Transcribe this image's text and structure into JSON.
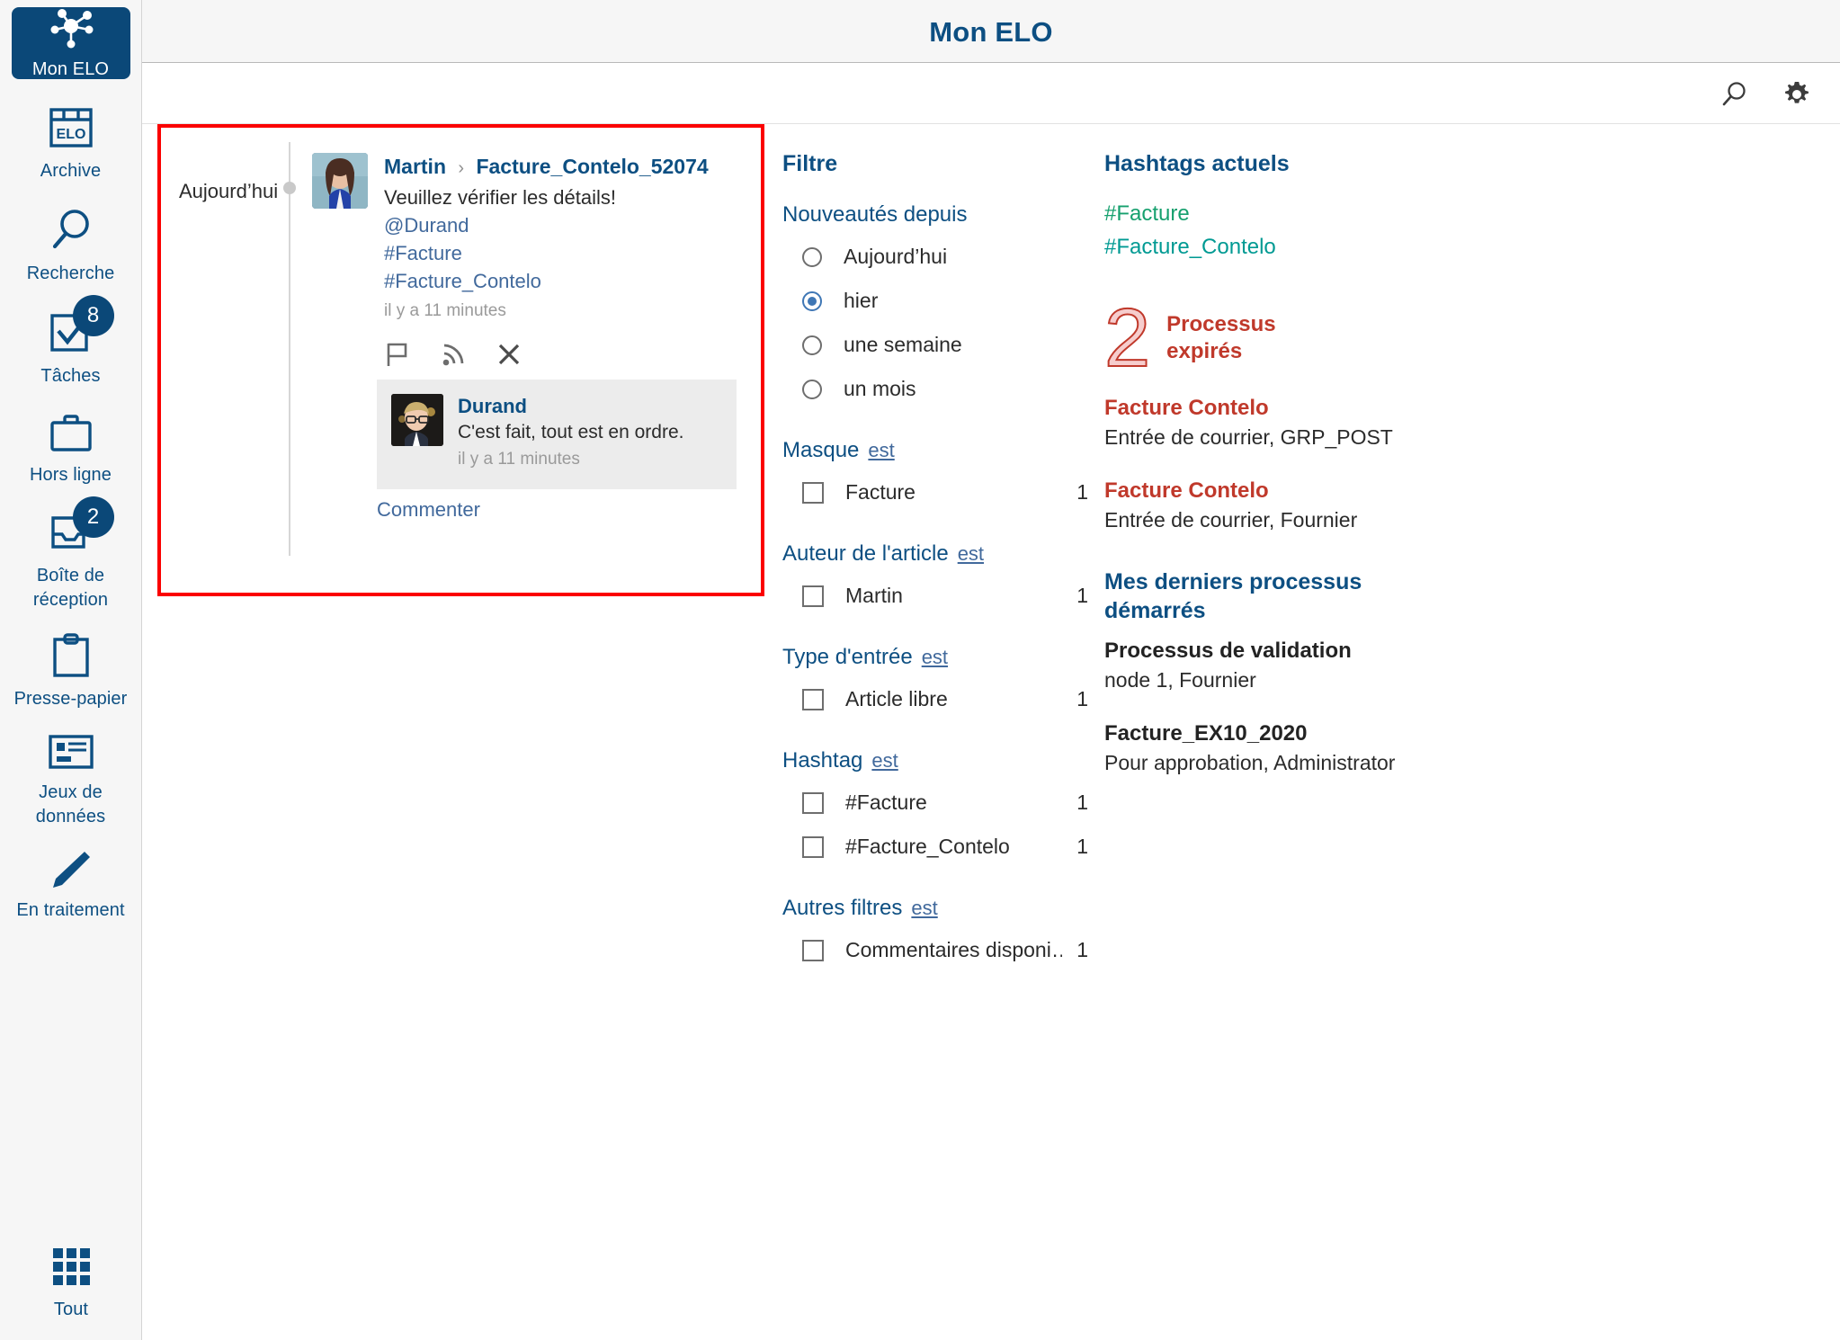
{
  "app": {
    "title": "Mon ELO"
  },
  "sidebar": {
    "items": [
      {
        "label": "Mon ELO",
        "icon": "network-nodes-icon",
        "active": true,
        "badge": null
      },
      {
        "label": "Archive",
        "icon": "elo-archive-icon",
        "active": false,
        "badge": null
      },
      {
        "label": "Recherche",
        "icon": "search-icon",
        "active": false,
        "badge": null
      },
      {
        "label": "Tâches",
        "icon": "checkbox-task-icon",
        "active": false,
        "badge": "8"
      },
      {
        "label": "Hors ligne",
        "icon": "briefcase-icon",
        "active": false,
        "badge": null
      },
      {
        "label": "Boîte de réception",
        "icon": "inbox-tray-icon",
        "active": false,
        "badge": "2"
      },
      {
        "label": "Presse-papier",
        "icon": "clipboard-icon",
        "active": false,
        "badge": null
      },
      {
        "label": "Jeux de données",
        "icon": "data-record-icon",
        "active": false,
        "badge": null
      },
      {
        "label": "En traitement",
        "icon": "pencil-icon",
        "active": false,
        "badge": null
      }
    ],
    "bottom": {
      "label": "Tout",
      "icon": "grid-apps-icon"
    }
  },
  "toolbar": {
    "search_icon": "search-icon",
    "settings_icon": "gear-icon"
  },
  "feed": {
    "day_label": "Aujourd’hui",
    "post": {
      "author": "Martin",
      "separator": "›",
      "target": "Facture_Contelo_52074",
      "text": "Veuillez vérifier les détails!",
      "mention": "@Durand",
      "hashtag1": "#Facture",
      "hashtag2": "#Facture_Contelo",
      "time": "il y a 11 minutes",
      "actions": [
        {
          "name": "flag-icon",
          "title": "flag"
        },
        {
          "name": "feed-subscribe-icon",
          "title": "subscribe"
        },
        {
          "name": "close-icon",
          "title": "close"
        }
      ]
    },
    "comment": {
      "author": "Durand",
      "text": "C'est fait, tout est en ordre.",
      "time": "il y a 11 minutes"
    },
    "comment_link": "Commenter"
  },
  "filters": {
    "title": "Filtre",
    "groups": [
      {
        "title": "Nouveautés depuis",
        "est": "",
        "type": "radio",
        "options": [
          {
            "label": "Aujourd’hui",
            "selected": false,
            "count": ""
          },
          {
            "label": "hier",
            "selected": true,
            "count": ""
          },
          {
            "label": "une semaine",
            "selected": false,
            "count": ""
          },
          {
            "label": "un mois",
            "selected": false,
            "count": ""
          }
        ]
      },
      {
        "title": "Masque",
        "est": "est",
        "type": "checkbox",
        "options": [
          {
            "label": "Facture",
            "selected": false,
            "count": "1"
          }
        ]
      },
      {
        "title": "Auteur de l'article",
        "est": "est",
        "type": "checkbox",
        "options": [
          {
            "label": "Martin",
            "selected": false,
            "count": "1"
          }
        ]
      },
      {
        "title": "Type d'entrée",
        "est": "est",
        "type": "checkbox",
        "options": [
          {
            "label": "Article libre",
            "selected": false,
            "count": "1"
          }
        ]
      },
      {
        "title": "Hashtag",
        "est": "est",
        "type": "checkbox",
        "options": [
          {
            "label": "#Facture",
            "selected": false,
            "count": "1"
          },
          {
            "label": "#Facture_Contelo",
            "selected": false,
            "count": "1"
          }
        ]
      },
      {
        "title": "Autres filtres",
        "est": "est",
        "type": "checkbox",
        "options": [
          {
            "label": "Commentaires disponi…",
            "selected": false,
            "count": "1"
          }
        ]
      }
    ]
  },
  "right": {
    "hashtags_title": "Hashtags actuels",
    "hashtags": [
      {
        "label": "#Facture",
        "color": "#16a06e"
      },
      {
        "label": "#Facture_Contelo",
        "color": "#009a93"
      }
    ],
    "expired": {
      "count": "2",
      "label_line1": "Processus",
      "label_line2": "expirés",
      "items": [
        {
          "name": "Facture Contelo",
          "sub": "Entrée de courrier, GRP_POST"
        },
        {
          "name": "Facture Contelo",
          "sub": "Entrée de courrier, Fournier"
        }
      ]
    },
    "started_title_line1": "Mes derniers processus",
    "started_title_line2": "démarrés",
    "started": [
      {
        "name": "Processus de validation",
        "sub": "node 1, Fournier"
      },
      {
        "name": "Facture_EX10_2020",
        "sub": "Pour approbation, Administrator"
      }
    ]
  },
  "colors": {
    "brand_blue": "#0b4878",
    "link_blue": "#41699c",
    "highlight_red": "#fb0000",
    "alert_red": "#c0392b"
  }
}
